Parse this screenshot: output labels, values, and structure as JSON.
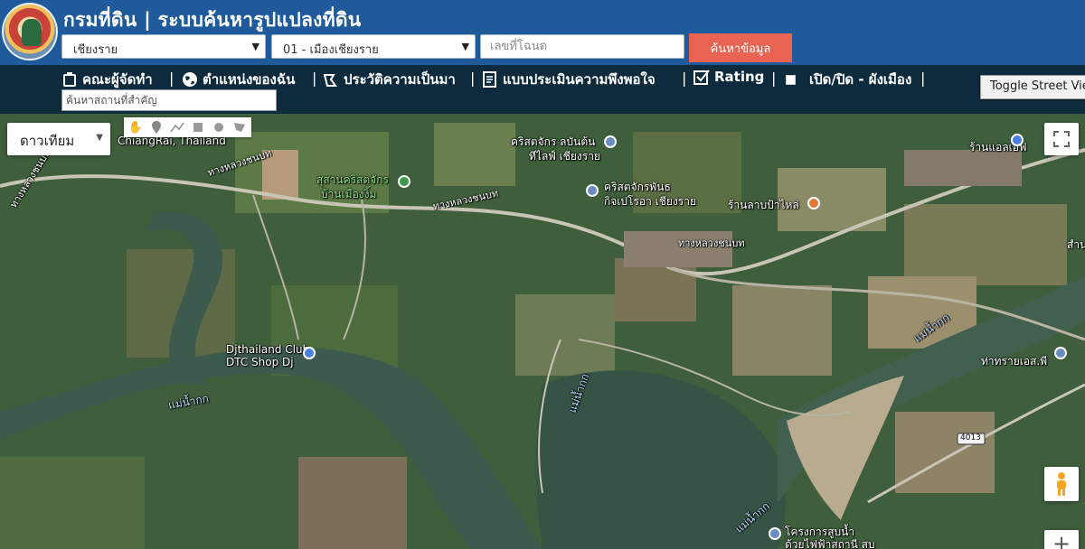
{
  "header": {
    "title": "กรมที่ดิน | ระบบค้นหารูปแปลงที่ดิน",
    "province_select": "เชียงราย",
    "district_select": "01 - เมืองเชียงราย",
    "deed_placeholder": "เลขที่โฉนด",
    "search_label": "ค้นหาข้อมูล"
  },
  "nav": {
    "items": [
      {
        "label": "คณะผู้จัดทำ",
        "icon": "team-icon"
      },
      {
        "label": "ตำแหน่งของฉัน",
        "icon": "globe-icon"
      },
      {
        "label": "ประวัติความเป็นมา",
        "icon": "history-icon"
      },
      {
        "label": "แบบประเมินความพึงพอใจ",
        "icon": "survey-icon"
      },
      {
        "label": "Rating",
        "icon": "checkbox-icon"
      },
      {
        "label": "เปิด/ปิด - ผังเมือง",
        "icon": "checkbox"
      }
    ],
    "separator": "|",
    "place_search_placeholder": "ค้นหาสถานที่สำคัญ",
    "street_view_label": "Toggle Street View"
  },
  "map": {
    "map_type": "ดาวเทียม",
    "labels": [
      {
        "text": "ChiangRai, Thailand",
        "kind": "plain"
      },
      {
        "text": "สุสานคริสตจักร",
        "kind": "green"
      },
      {
        "text": "บ้านเมืองงิ้ม",
        "kind": "green"
      },
      {
        "text": "คริสตจักร ลบันต้น",
        "kind": "plain"
      },
      {
        "text": "ทีไลฟ์ เชียงราย",
        "kind": "plain"
      },
      {
        "text": "คริสตจักรพันธ",
        "kind": "plain"
      },
      {
        "text": "กิจเปโรอา เชียงราย",
        "kind": "plain"
      },
      {
        "text": "ร้านลาบป้าไหล่",
        "kind": "plain"
      },
      {
        "text": "ร้านแอลเอฟ",
        "kind": "plain"
      },
      {
        "text": "ทางหลวงชนบท",
        "kind": "road"
      },
      {
        "text": "ทางหลวงชนบท",
        "kind": "road"
      },
      {
        "text": "ทางหลวงชนบท",
        "kind": "road"
      },
      {
        "text": "ทางหลวงชนบท",
        "kind": "road"
      },
      {
        "text": "Djthailand Club.",
        "kind": "plain"
      },
      {
        "text": "DTC Shop Dj",
        "kind": "plain"
      },
      {
        "text": "แม่น้ำกก",
        "kind": "water"
      },
      {
        "text": "แม่น้ำกก",
        "kind": "water"
      },
      {
        "text": "แม่น้ำกก",
        "kind": "water"
      },
      {
        "text": "แม่น้ำกก",
        "kind": "water"
      },
      {
        "text": "ท่าทรายเอส.พี",
        "kind": "plain"
      },
      {
        "text": "โครงการสูบน้ำ",
        "kind": "plain"
      },
      {
        "text": "ด้วยไฟฟ้าสถานี สบ",
        "kind": "plain"
      },
      {
        "text": "สำน",
        "kind": "plain"
      }
    ],
    "route_shield": "4013",
    "colors": {
      "header_blue": "#1f5a9b",
      "nav_dark": "#0e2a3d",
      "search_button": "#e96352",
      "river": "#3d5a4e"
    }
  }
}
